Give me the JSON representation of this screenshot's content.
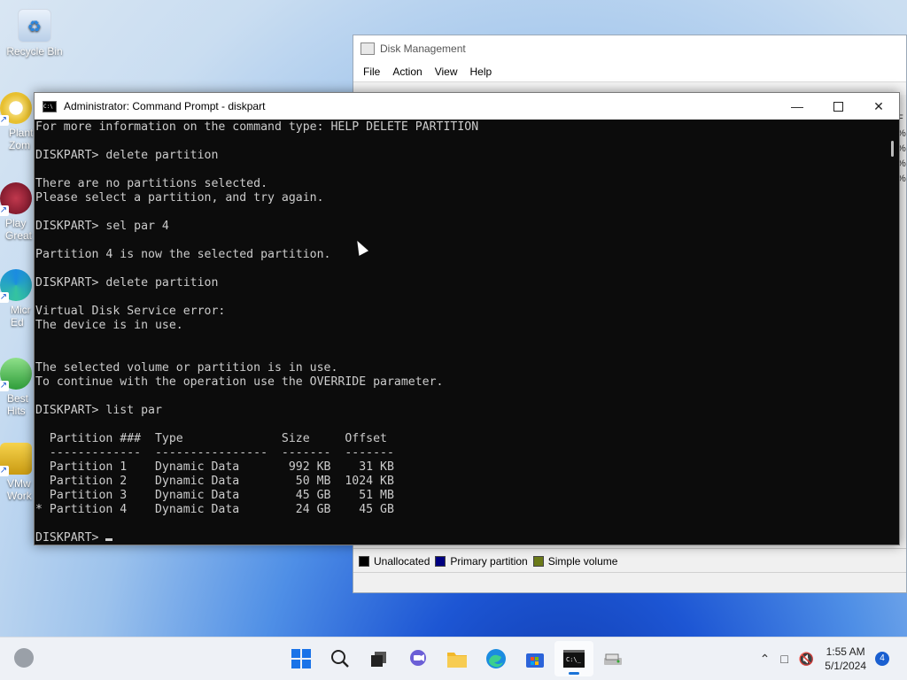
{
  "desktop": {
    "icons": [
      {
        "label": "Recycle Bin"
      },
      {
        "label": "Plant\nZom"
      },
      {
        "label": "Play\nGreat"
      },
      {
        "label": "Micr\nEd"
      },
      {
        "label": "Best\nHits"
      },
      {
        "label": "VMw\nWork"
      }
    ]
  },
  "disk_management": {
    "title": "Disk Management",
    "menu": [
      "File",
      "Action",
      "View",
      "Help"
    ],
    "right_edge": [
      "F",
      "%",
      "%",
      "%",
      "%"
    ],
    "legend": [
      {
        "label": "Unallocated",
        "color": "#000000"
      },
      {
        "label": "Primary partition",
        "color": "#000080"
      },
      {
        "label": "Simple volume",
        "color": "#6b7a18"
      }
    ]
  },
  "cmd": {
    "title": "Administrator: Command Prompt - diskpart",
    "lines": [
      "For more information on the command type: HELP DELETE PARTITION",
      "",
      "DISKPART> delete partition",
      "",
      "There are no partitions selected.",
      "Please select a partition, and try again.",
      "",
      "DISKPART> sel par 4",
      "",
      "Partition 4 is now the selected partition.",
      "",
      "DISKPART> delete partition",
      "",
      "Virtual Disk Service error:",
      "The device is in use.",
      "",
      "",
      "The selected volume or partition is in use.",
      "To continue with the operation use the OVERRIDE parameter.",
      "",
      "DISKPART> list par",
      "",
      "  Partition ###  Type              Size     Offset",
      "  -------------  ----------------  -------  -------",
      "  Partition 1    Dynamic Data       992 KB    31 KB",
      "  Partition 2    Dynamic Data        50 MB  1024 KB",
      "  Partition 3    Dynamic Data        45 GB    51 MB",
      "* Partition 4    Dynamic Data        24 GB    45 GB",
      "",
      "DISKPART> "
    ]
  },
  "taskbar": {
    "apps": [
      "start-icon",
      "search-icon",
      "task-view-icon",
      "chat-icon",
      "file-explorer-icon",
      "edge-icon",
      "store-icon",
      "terminal-icon",
      "disk-management-icon"
    ],
    "active_app": "terminal-icon",
    "time": "1:55 AM",
    "date": "5/1/2024",
    "notification_count": "4"
  }
}
